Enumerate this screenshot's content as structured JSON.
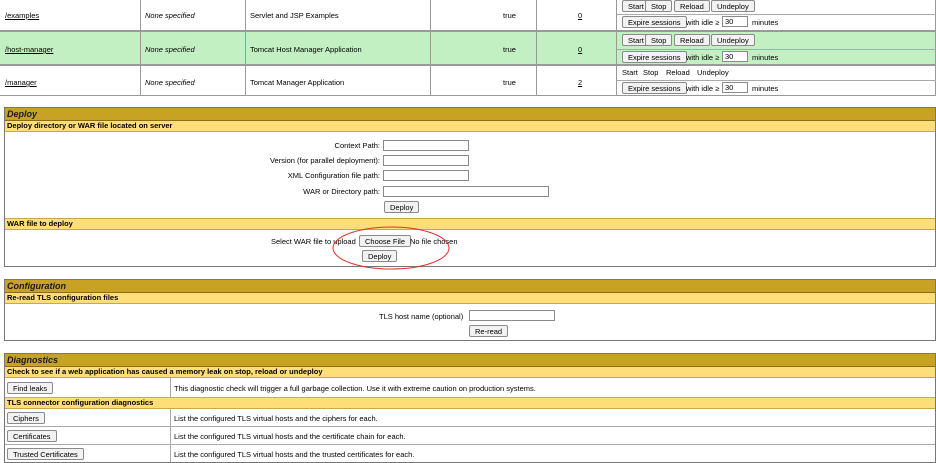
{
  "apps": [
    {
      "path": "/examples",
      "version": "None specified",
      "display_name": "Servlet and JSP Examples",
      "running": "true",
      "sessions": "0",
      "commands": [
        "Start",
        "Stop",
        "Reload",
        "Undeploy"
      ],
      "expire_label": "Expire sessions",
      "idle_text": "with idle ≥",
      "idle_value": "30",
      "minutes_text": "minutes",
      "row_color": "#ffffff"
    },
    {
      "path": "/host-manager",
      "version": "None specified",
      "display_name": "Tomcat Host Manager Application",
      "running": "true",
      "sessions": "0",
      "commands": [
        "Start",
        "Stop",
        "Reload",
        "Undeploy"
      ],
      "expire_label": "Expire sessions",
      "idle_text": "with idle ≥",
      "idle_value": "30",
      "minutes_text": "minutes",
      "row_color": "#c2f0c2"
    },
    {
      "path": "/manager",
      "version": "None specified",
      "display_name": "Tomcat Manager Application",
      "running": "true",
      "sessions": "2",
      "commands": [
        "Start",
        "Stop",
        "Reload",
        "Undeploy"
      ],
      "expire_label": "Expire sessions",
      "idle_text": "with idle ≥",
      "idle_value": "30",
      "minutes_text": "minutes",
      "row_color": "#ffffff"
    }
  ],
  "deploy": {
    "title": "Deploy",
    "server_subtitle": "Deploy directory or WAR file located on server",
    "context_path_label": "Context Path:",
    "version_label": "Version (for parallel deployment):",
    "xml_label": "XML Configuration file path:",
    "war_dir_label": "WAR or Directory path:",
    "deploy_button": "Deploy",
    "war_subtitle": "WAR file to deploy",
    "select_war_label": "Select WAR file to upload",
    "choose_file_button": "Choose File",
    "no_file_text": "No file chosen",
    "upload_deploy_button": "Deploy"
  },
  "configuration": {
    "title": "Configuration",
    "subtitle": "Re-read TLS configuration files",
    "host_label": "TLS host name (optional)",
    "reread_button": "Re-read"
  },
  "diagnostics": {
    "title": "Diagnostics",
    "leak_subtitle": "Check to see if a web application has caused a memory leak on stop, reload or undeploy",
    "find_leaks_button": "Find leaks",
    "find_leaks_desc": "This diagnostic check will trigger a full garbage collection. Use it with extreme caution on production systems.",
    "tls_subtitle": "TLS connector configuration diagnostics",
    "ciphers_button": "Ciphers",
    "ciphers_desc": "List the configured TLS virtual hosts and the ciphers for each.",
    "certificates_button": "Certificates",
    "certificates_desc": "List the configured TLS virtual hosts and the certificate chain for each.",
    "trusted_button": "Trusted Certificates",
    "trusted_desc": "List the configured TLS virtual hosts and the trusted certificates for each."
  },
  "colors": {
    "section_header": "#c8a223",
    "subsection_header": "#ffde7a",
    "running_row": "#c2f0c2",
    "annotation_circle": "#e0302a"
  }
}
